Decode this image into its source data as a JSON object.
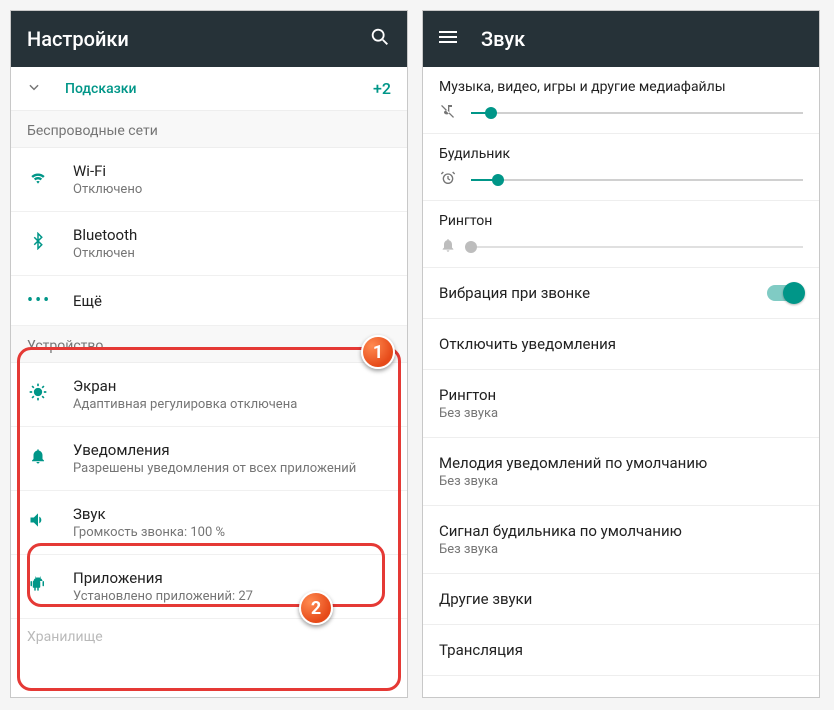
{
  "left": {
    "title": "Настройки",
    "hints_label": "Подсказки",
    "hints_count": "+2",
    "section_wireless": "Беспроводные сети",
    "wifi": {
      "title": "Wi-Fi",
      "sub": "Отключено"
    },
    "bluetooth": {
      "title": "Bluetooth",
      "sub": "Отключен"
    },
    "more": {
      "title": "Ещё"
    },
    "section_device": "Устройство",
    "display": {
      "title": "Экран",
      "sub": "Адаптивная регулировка отключена"
    },
    "notifications": {
      "title": "Уведомления",
      "sub": "Разрешены уведомления от всех приложений"
    },
    "sound": {
      "title": "Звук",
      "sub": "Громкость звонка: 100 %"
    },
    "apps": {
      "title": "Приложения",
      "sub": "Установлено приложений: 27"
    },
    "cutoff": "Хранилище"
  },
  "right": {
    "title": "Звук",
    "media_label": "Музыка, видео, игры и другие медиафайлы",
    "media_value": 6,
    "alarm_label": "Будильник",
    "alarm_value": 8,
    "ring_label": "Рингтон",
    "ring_value": 0,
    "vibrate_label": "Вибрация при звонке",
    "block_notif": "Отключить уведомления",
    "ringtone": {
      "title": "Рингтон",
      "sub": "Без звука"
    },
    "default_notif": {
      "title": "Мелодия уведомлений по умолчанию",
      "sub": "Без звука"
    },
    "alarm_sound": {
      "title": "Сигнал будильника по умолчанию",
      "sub": "Без звука"
    },
    "other_sounds": "Другие звуки",
    "cast": "Трансляция"
  },
  "markers": {
    "one": "1",
    "two": "2"
  }
}
